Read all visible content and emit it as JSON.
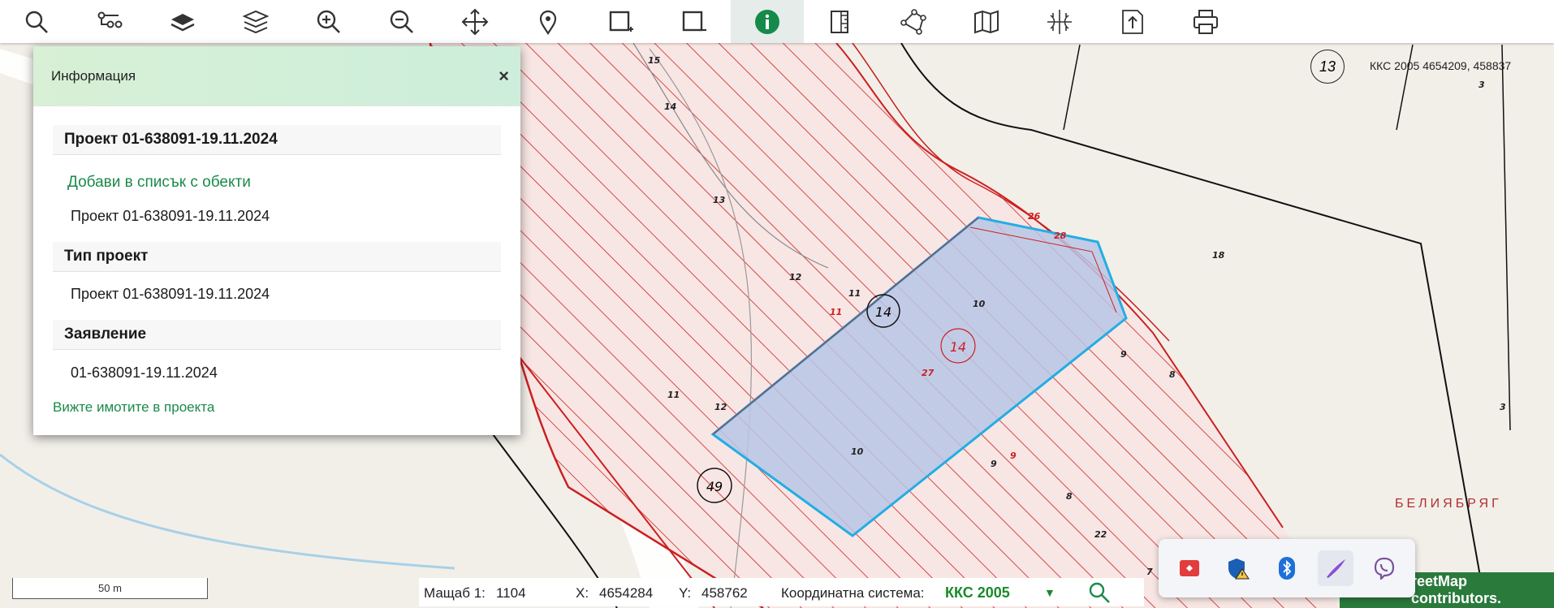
{
  "toolbar": {
    "tools": [
      {
        "name": "search-tool-button",
        "icon": "search-icon"
      },
      {
        "name": "route-tool-button",
        "icon": "route-icon"
      },
      {
        "name": "layer-tool-button",
        "icon": "layer-icon"
      },
      {
        "name": "layers-tool-button",
        "icon": "layers-icon"
      },
      {
        "name": "zoom-in-button",
        "icon": "zoom-in-icon"
      },
      {
        "name": "zoom-out-button",
        "icon": "zoom-out-icon"
      },
      {
        "name": "pan-button",
        "icon": "move-icon"
      },
      {
        "name": "location-button",
        "icon": "pin-icon"
      },
      {
        "name": "select-add-button",
        "icon": "select-add-icon"
      },
      {
        "name": "select-remove-button",
        "icon": "select-remove-icon"
      },
      {
        "name": "info-button",
        "icon": "info-icon",
        "active": true
      },
      {
        "name": "measure-button",
        "icon": "ruler-icon"
      },
      {
        "name": "polygon-button",
        "icon": "polygon-icon"
      },
      {
        "name": "map-button",
        "icon": "map-icon"
      },
      {
        "name": "grid-button",
        "icon": "grid-icon"
      },
      {
        "name": "export-button",
        "icon": "export-icon"
      },
      {
        "name": "print-button",
        "icon": "print-icon"
      }
    ]
  },
  "info_panel": {
    "title": "Информация",
    "close": "×",
    "project_header": "Проект 01-638091-19.11.2024",
    "add_link": "Добави в списък с обекти",
    "project_value": "Проект 01-638091-19.11.2024",
    "type_header": "Тип проект",
    "type_value": "Проект 01-638091-19.11.2024",
    "application_header": "Заявление",
    "application_value": "01-638091-19.11.2024",
    "view_link": "Вижте имотите в проекта"
  },
  "status": {
    "scale_label": "Мащаб 1:",
    "scale_value": "1104",
    "x_label": "X:",
    "x_value": "4654284",
    "y_label": "Y:",
    "y_value": "458762",
    "crs_label": "Координатна система:",
    "crs_value": "ККС 2005",
    "crs_arrow": "▼"
  },
  "scalebar": "50 m",
  "top_coords": "ККС 2005 4654209, 458837",
  "map_labels": {
    "badge_13": "13",
    "badge_14a": "14",
    "badge_14b": "14",
    "badge_49": "49",
    "place": "БЕЛИЯБРЯГ",
    "numbers": [
      "15",
      "14",
      "13",
      "12",
      "11",
      "11",
      "12",
      "11",
      "10",
      "10",
      "9",
      "9",
      "8",
      "8",
      "9",
      "27",
      "26",
      "28",
      "18",
      "3",
      "3",
      "22",
      "7"
    ]
  },
  "osm_credit": "reetMap contributors.",
  "colors": {
    "accent_green": "#1a8a4a",
    "highlight_blue": "#22aee3",
    "hatch_red": "#cc1f1f"
  }
}
